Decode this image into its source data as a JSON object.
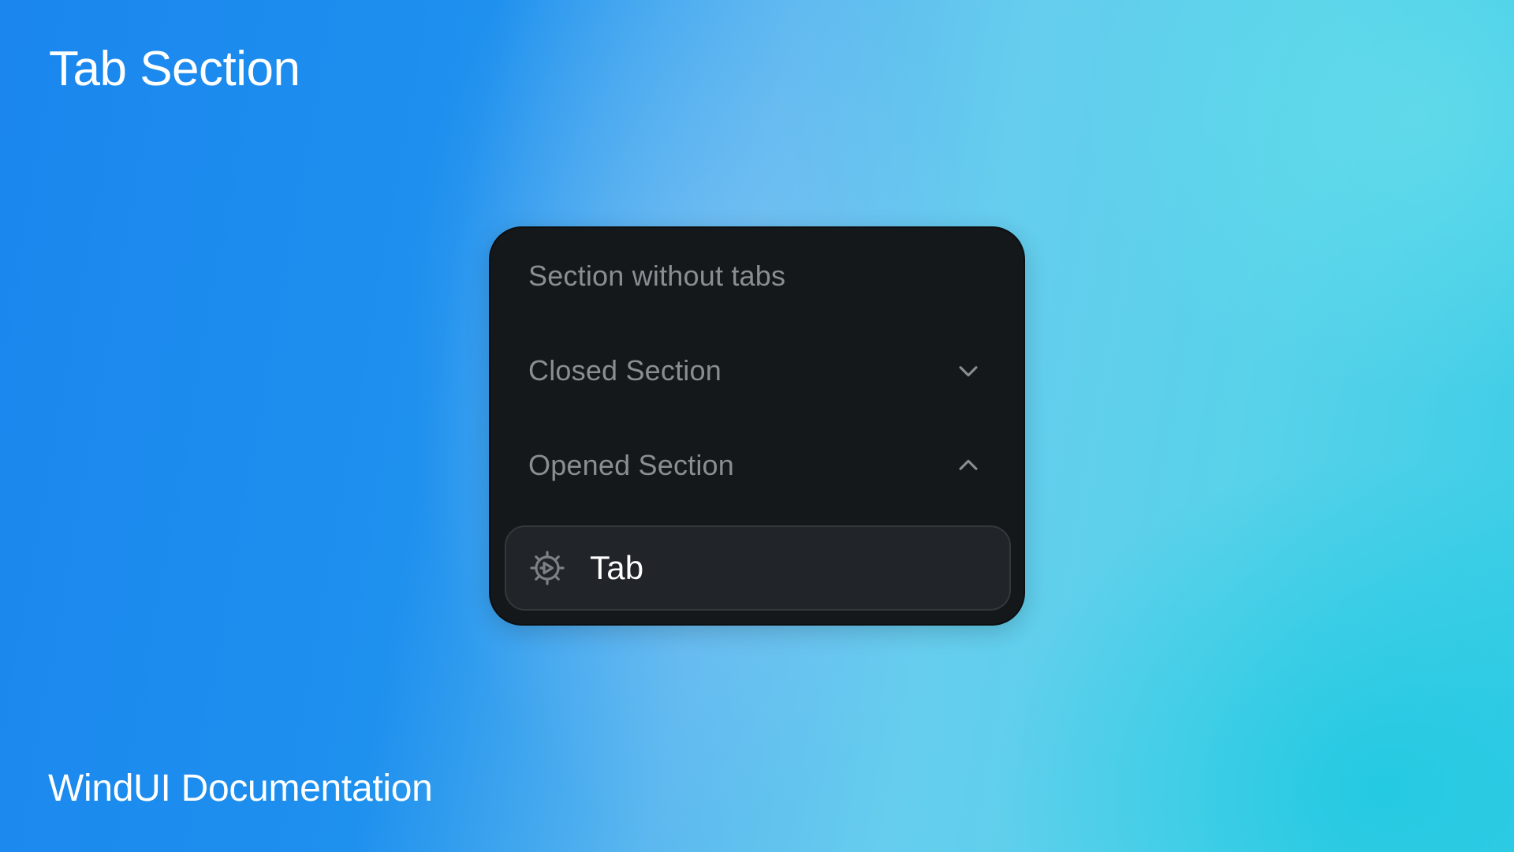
{
  "page": {
    "title": "Tab Section",
    "footer": "WindUI Documentation"
  },
  "panel": {
    "sections": [
      {
        "label": "Section without tabs",
        "state": "none"
      },
      {
        "label": "Closed Section",
        "state": "closed",
        "icon": "chevron-down-icon"
      },
      {
        "label": "Opened Section",
        "state": "opened",
        "icon": "chevron-up-icon"
      }
    ],
    "tab": {
      "label": "Tab",
      "icon": "gear-icon"
    }
  },
  "colors": {
    "panel_bg": "#15181b",
    "tab_bg": "#212529",
    "muted_text": "#8a8e93",
    "text": "#ffffff"
  }
}
